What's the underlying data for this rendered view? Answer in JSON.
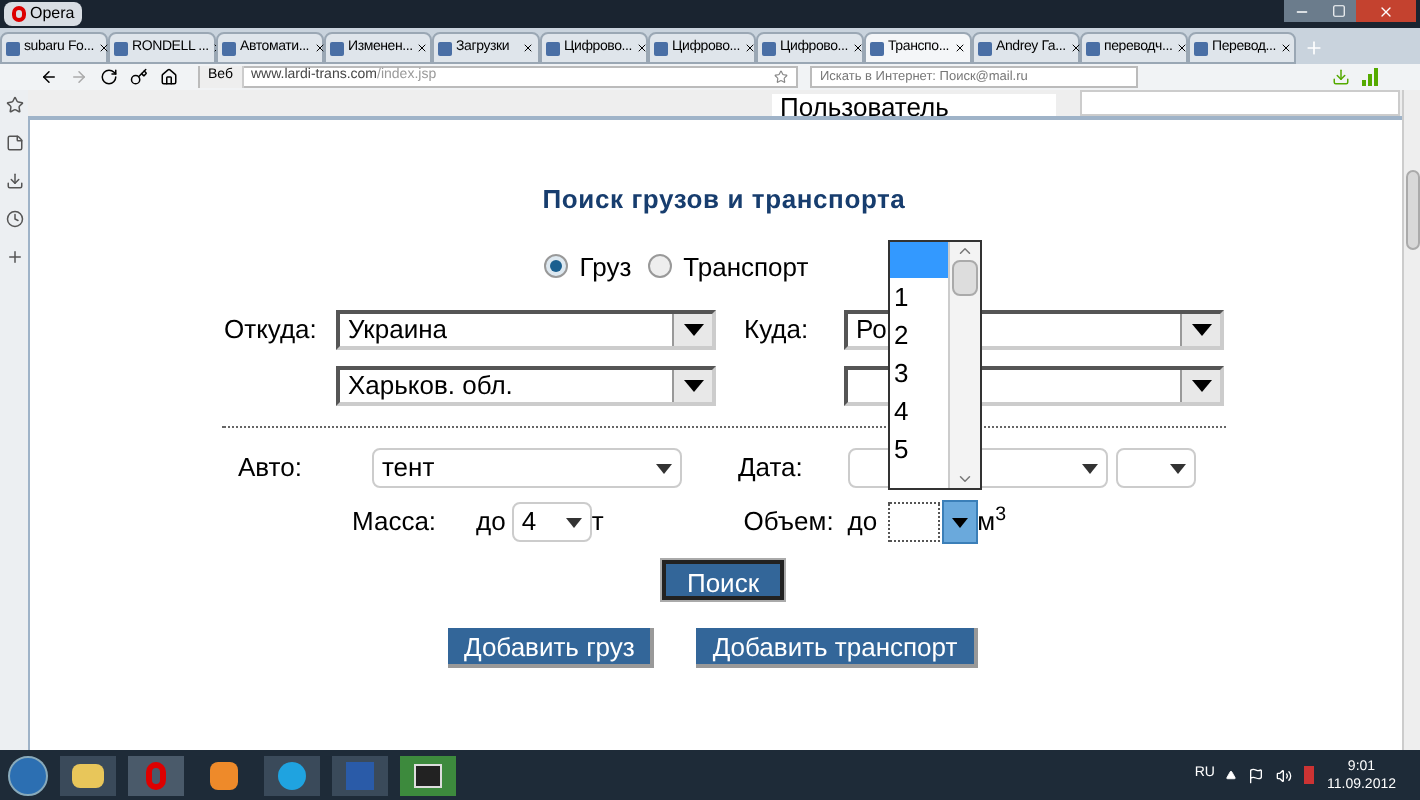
{
  "window": {
    "menu_button": "Opera"
  },
  "tabs": [
    {
      "label": "subaru Fo...",
      "selected": false
    },
    {
      "label": "RONDELL ...",
      "selected": false
    },
    {
      "label": "Автомати...",
      "selected": false
    },
    {
      "label": "Изменен...",
      "selected": false
    },
    {
      "label": "Загрузки",
      "selected": false
    },
    {
      "label": "Цифрово...",
      "selected": false
    },
    {
      "label": "Цифрово...",
      "selected": false
    },
    {
      "label": "Цифрово...",
      "selected": false
    },
    {
      "label": "Транспо...",
      "selected": true
    },
    {
      "label": "Andrey Га...",
      "selected": false
    },
    {
      "label": "переводч...",
      "selected": false
    },
    {
      "label": "Перевод...",
      "selected": false
    }
  ],
  "address_bar": {
    "site_badge": "Веб",
    "url_host": "www.lardi-trans.com",
    "url_path": "/index.jsp"
  },
  "search_field": {
    "placeholder": "Искать в Интернет: Поиск@mail.ru"
  },
  "user_select": {
    "value": "Пользователь"
  },
  "form": {
    "title": "Поиск грузов и транспорта",
    "search_type": [
      {
        "label": "Груз",
        "selected": true
      },
      {
        "label": "Транспорт",
        "selected": false
      }
    ],
    "from": {
      "label": "Откуда:",
      "country": "Украина",
      "region": "Харьков. обл."
    },
    "to": {
      "label": "Куда:",
      "country": "Ро"
    },
    "vehicle": {
      "label": "Авто:",
      "value": "тент"
    },
    "date": {
      "label": "Дата:"
    },
    "mass": {
      "label": "Масса:",
      "prefix": "до",
      "value": "4",
      "unit": "т"
    },
    "volume": {
      "label": "Объем:",
      "prefix": "до",
      "unit": "м$^{3}$"
    },
    "volume_list": {
      "blank_selected": true,
      "options": [
        {
          "label": "1",
          "selected": false
        },
        {
          "label": "2",
          "selected": false
        },
        {
          "label": "3",
          "selected": false
        },
        {
          "label": "4",
          "selected": false
        },
        {
          "label": "5",
          "selected": false
        }
      ]
    },
    "search_button": "Поиск",
    "add_buttons": [
      "Добавить груз",
      "Добавить транспорт"
    ]
  },
  "taskbar": {
    "language": "RU",
    "time": "9:01",
    "date": "11.09.2012"
  }
}
